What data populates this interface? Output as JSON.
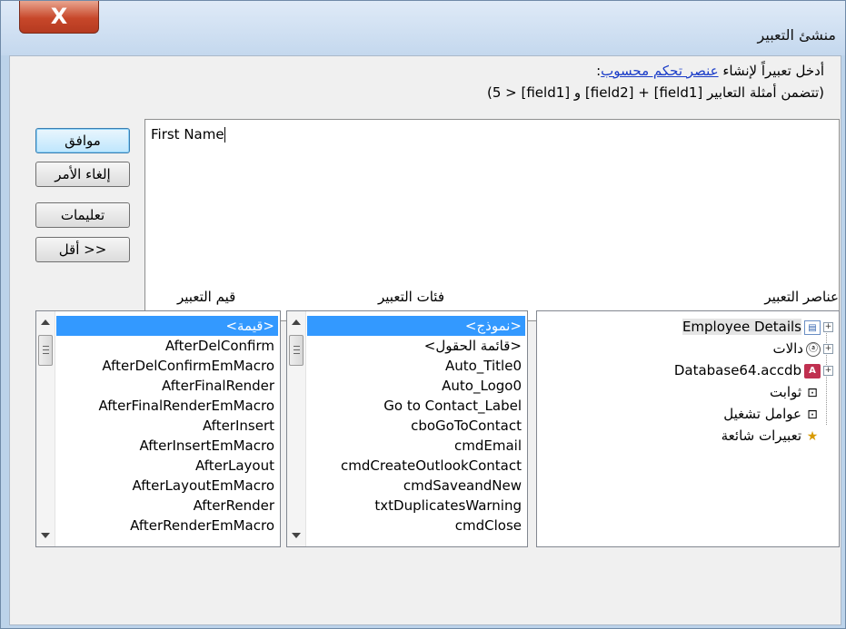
{
  "window": {
    "title": "منشئ التعبير",
    "close_label": "X"
  },
  "instructions": {
    "prefix": "أدخل تعبيراً لإنشاء ",
    "link": "عنصر تحكم محسوب",
    "suffix": ":",
    "examples": "(تتضمن أمثلة التعابير [field1] + [field2] و [field1] < 5)"
  },
  "expression": {
    "value": "First Name"
  },
  "buttons": {
    "ok": "موافق",
    "cancel": "إلغاء الأمر",
    "help": "تعليمات",
    "less": "<< أقل"
  },
  "headers": {
    "elements": "عناصر التعبير",
    "categories": "فئات التعبير",
    "values": "قيم التعبير"
  },
  "elements": [
    {
      "label": "Employee Details",
      "icon": "form-icon",
      "expand": "+"
    },
    {
      "label": "دالات",
      "icon": "function-icon",
      "expand": "+"
    },
    {
      "label": "Database64.accdb",
      "icon": "database-icon",
      "expand": "+"
    },
    {
      "label": "ثوابت",
      "icon": "constants-icon",
      "expand": ""
    },
    {
      "label": "عوامل تشغيل",
      "icon": "operators-icon",
      "expand": ""
    },
    {
      "label": "تعبيرات شائعة",
      "icon": "common-expressions-icon",
      "expand": ""
    }
  ],
  "categories": [
    "<نموذج>",
    "<قائمة الحقول>",
    "Auto_Title0",
    "Auto_Logo0",
    "Go to Contact_Label",
    "cboGoToContact",
    "cmdEmail",
    "cmdCreateOutlookContact",
    "cmdSaveandNew",
    "txtDuplicatesWarning",
    "cmdClose"
  ],
  "values": [
    "<قيمة>",
    "AfterDelConfirm",
    "AfterDelConfirmEmMacro",
    "AfterFinalRender",
    "AfterFinalRenderEmMacro",
    "AfterInsert",
    "AfterInsertEmMacro",
    "AfterLayout",
    "AfterLayoutEmMacro",
    "AfterRender",
    "AfterRenderEmMacro"
  ],
  "selection": {
    "category_index": 0,
    "value_index": 0,
    "highlight_color": "#3399ff"
  }
}
